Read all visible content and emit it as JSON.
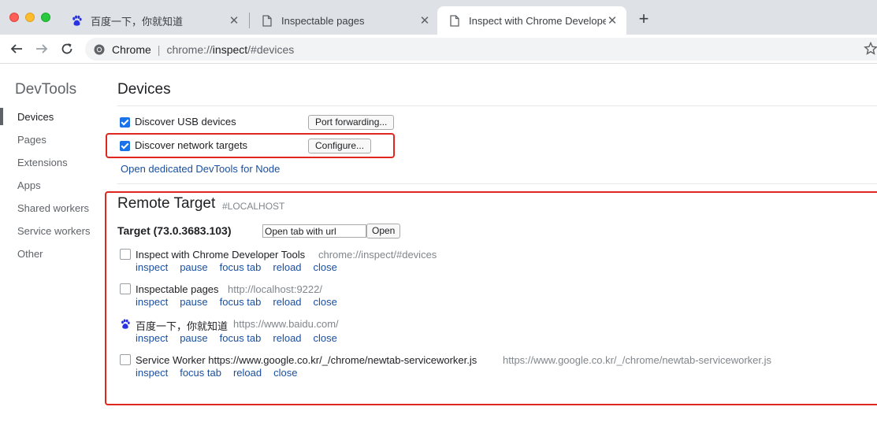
{
  "tabs": [
    {
      "title": "百度一下，你就知道",
      "icon": "baidu-paw-icon"
    },
    {
      "title": "Inspectable pages",
      "icon": "document-icon"
    },
    {
      "title": "Inspect with Chrome Developer Tools",
      "icon": "document-icon",
      "active": true
    }
  ],
  "tab_close_glyph": "✕",
  "new_tab_glyph": "+",
  "omnibox": {
    "scheme": "Chrome",
    "divider": "|",
    "url_prefix": "chrome://",
    "url_host": "inspect",
    "url_suffix": "/#devices"
  },
  "sidebar": {
    "title": "DevTools",
    "items": [
      "Devices",
      "Pages",
      "Extensions",
      "Apps",
      "Shared workers",
      "Service workers",
      "Other"
    ],
    "active": "Devices"
  },
  "devices": {
    "heading": "Devices",
    "discover_usb": {
      "label": "Discover USB devices",
      "checked": true
    },
    "port_forwarding_label": "Port forwarding...",
    "discover_network": {
      "label": "Discover network targets",
      "checked": true
    },
    "configure_label": "Configure...",
    "node_link": "Open dedicated DevTools for Node"
  },
  "remote": {
    "heading": "Remote Target",
    "subheading": "#LOCALHOST",
    "target": "Target (73.0.3683.103)",
    "url_input_placeholder": "Open tab with url",
    "open_label": "Open",
    "items": [
      {
        "title": "Inspect with Chrome Developer Tools",
        "url": "chrome://inspect/#devices",
        "icon": "blank-page-icon",
        "actions": [
          "inspect",
          "pause",
          "focus tab",
          "reload",
          "close"
        ]
      },
      {
        "title": "Inspectable pages",
        "url": "http://localhost:9222/",
        "icon": "blank-page-icon",
        "actions": [
          "inspect",
          "pause",
          "focus tab",
          "reload",
          "close"
        ]
      },
      {
        "title": "百度一下，你就知道",
        "url": "https://www.baidu.com/",
        "icon": "baidu-paw-icon",
        "actions": [
          "inspect",
          "pause",
          "focus tab",
          "reload",
          "close"
        ]
      },
      {
        "title": "Service Worker https://www.google.co.kr/_/chrome/newtab-serviceworker.js",
        "url": "https://www.google.co.kr/_/chrome/newtab-serviceworker.js",
        "icon": "blank-page-icon",
        "actions": [
          "inspect",
          "focus tab",
          "reload",
          "close"
        ]
      }
    ]
  },
  "colors": {
    "highlight": "#e0271f",
    "link": "#1a4fa0",
    "checkbox": "#1a73e8"
  }
}
